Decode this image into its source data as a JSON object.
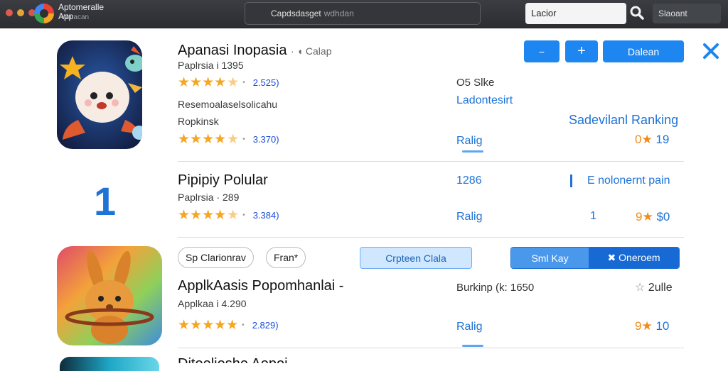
{
  "window": {
    "app_name_line1": "Aptomeralle",
    "app_name_line2": "App",
    "app_name_line2_muted": "Wa  acan",
    "address": "Capdsdasget",
    "address_muted": "wdhdan",
    "search_value": "Lacior",
    "search_button": "Slaoant",
    "colors": {
      "dot1": "#e05a4f",
      "dot2": "#e3a43c",
      "dot3": "#d9534f"
    }
  },
  "toolbar": {
    "btn1_label": "−",
    "btn2_label": "+",
    "primary_label": "Dalean",
    "close_icon": "close-icon"
  },
  "rows": [
    {
      "title": "Apanasi Inopasia",
      "title_tag": "· ◖ Calap",
      "sub1": "Paplrsia i 1395",
      "rating1": "4.5",
      "count1": "2.525)",
      "sub2": "Resemoalaselsolicahu",
      "sub3": "Ropkinsk",
      "rating2": "4.5",
      "count2": "3.370)",
      "mid_label_dark": "O5 Slke",
      "mid_label_blue": "Ladontesirt",
      "mid_label_rating": "Ralig",
      "right_label": "Sadevilanl Ranking",
      "right_value": "19",
      "right_value_prefix": "0★"
    },
    {
      "rank": "1",
      "title": "Pipipiy Polular",
      "sub1": "Paplrsia · 289",
      "rating1": "4.5",
      "count1": "3.384)",
      "mid_value": "1286",
      "mid_label_rating": "Ralig",
      "right_label": "E nolonernt pain",
      "right_small": "1",
      "right_value": "$0",
      "right_value_prefix": "9★"
    },
    {
      "chip1": "Sp Clarionrav",
      "chip2": "Fran*",
      "pill": "Crpteen Clala",
      "seg_a": "Sml Kay",
      "seg_b": "✖ Oneroem",
      "title": "ApplkAasis Popomhanlai -",
      "sub1": "Applkaa i 4.290",
      "rating1": "5",
      "count1": "2.829)",
      "mid_label_dark": "Burkinp (k: 1650",
      "mid_label_rating": "Ralig",
      "right_label": "2ulle",
      "right_value": "10",
      "right_value_prefix": "9★"
    }
  ],
  "partial_row": {
    "title": "Ditoelieshe Aepoi"
  }
}
